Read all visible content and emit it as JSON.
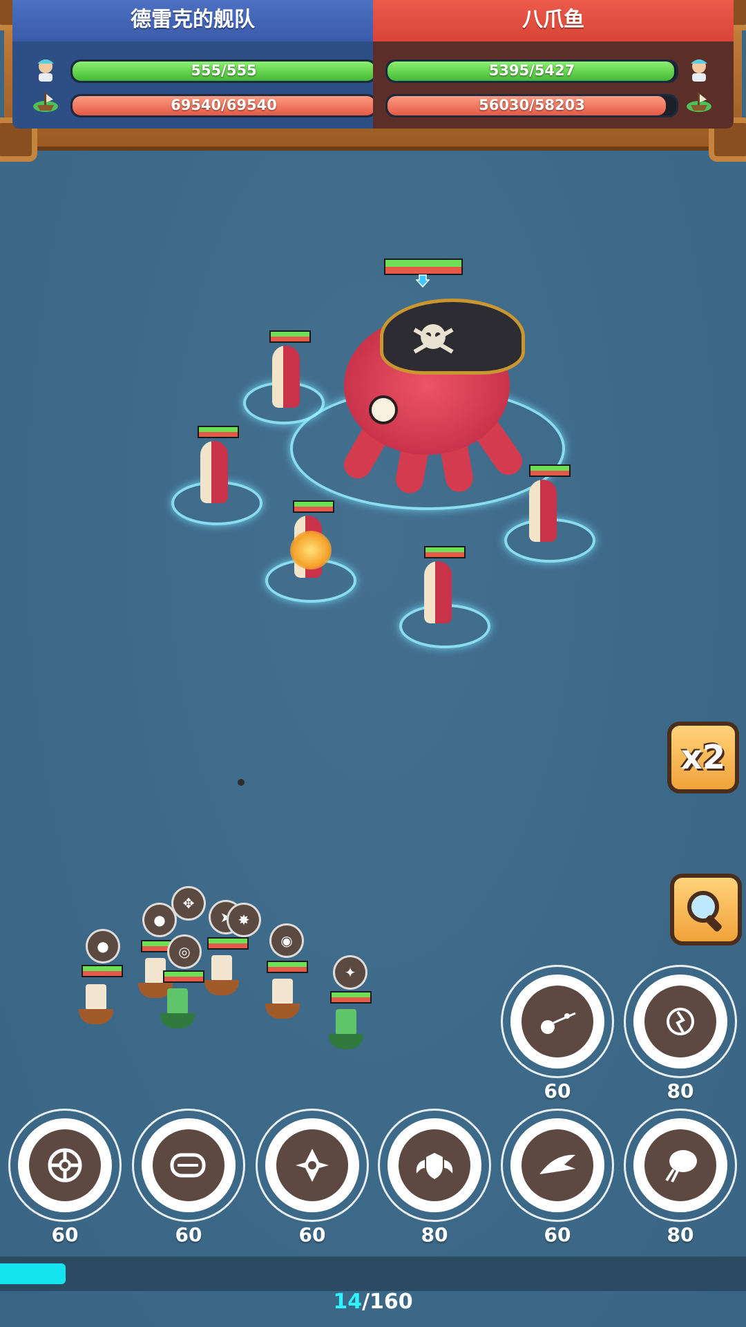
{
  "hud": {
    "player": {
      "name": "德雷克的舰队",
      "crew_hp": "555/555",
      "crew_ratio": 1.0,
      "ship_hp": "69540/69540",
      "ship_ratio": 1.0
    },
    "enemy": {
      "name": "八爪鱼",
      "crew_hp": "5395/5427",
      "crew_ratio": 0.994,
      "ship_hp": "56030/58203",
      "ship_ratio": 0.963
    },
    "icons": {
      "crew": "sailor-icon",
      "ship": "ship-icon"
    }
  },
  "controls": {
    "speed_label": "x2",
    "inspect_icon": "magnifier-icon"
  },
  "skills": [
    {
      "icon": "cannonball-icon",
      "cost": "60"
    },
    {
      "icon": "storm-icon",
      "cost": "80"
    },
    {
      "icon": "wheel-icon",
      "cost": "60"
    },
    {
      "icon": "hook-icon",
      "cost": "60"
    },
    {
      "icon": "shield-spikes-icon",
      "cost": "60"
    },
    {
      "icon": "winged-shield-icon",
      "cost": "80"
    },
    {
      "icon": "shark-icon",
      "cost": "60"
    },
    {
      "icon": "balloon-icon",
      "cost": "80"
    }
  ],
  "energy": {
    "current": "14",
    "separator": "/",
    "max": "160",
    "ratio": 0.0875
  },
  "colors": {
    "player_banner": "#3b5ba8",
    "enemy_banner": "#d84536",
    "hp_green": "#43b935",
    "hp_red": "#e35a45",
    "energy": "#16e3f0"
  }
}
